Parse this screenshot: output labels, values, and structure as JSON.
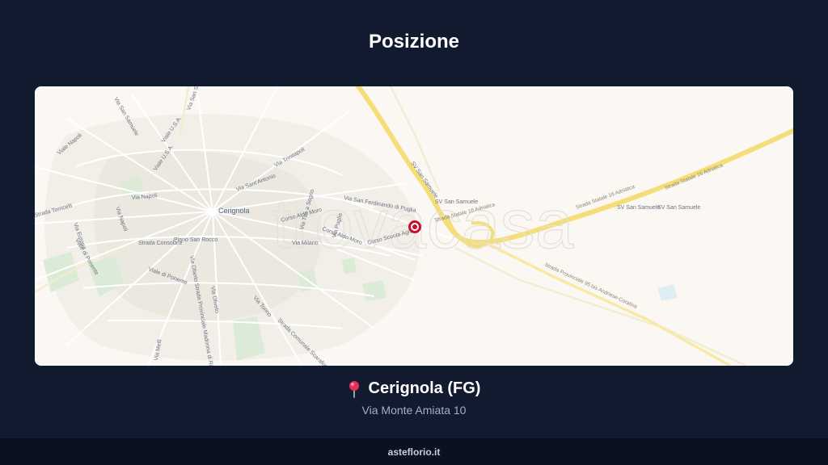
{
  "header": {
    "title": "Posizione"
  },
  "map": {
    "watermark": "trovacasa",
    "city_label": "Cerignola",
    "street_labels": [
      "Viale U.S.A.",
      "Viale U.S.A.",
      "Viale Napoli",
      "Via Napoli",
      "Via Napoli",
      "Viale di Ponente",
      "Viale di Ponente",
      "Strada Consolare",
      "Piano San Rocco",
      "Via Sant'Antonio",
      "Via Tiro a Segno",
      "Via Trinitapoli",
      "Corso Aldo Moro",
      "Corso Aldo Moro",
      "Via Milano",
      "Via Puglia",
      "Corso Scuola Agraria",
      "Via San Ferdinando di Puglia",
      "SV San Samuele",
      "SV San Samuele",
      "SV San Samuele",
      "SV San Samuele",
      "Strada Statale 16 Adriatica",
      "Strada Statale 16 Adriatica",
      "Strada Statale 16 Adriatica",
      "Strada Provinciale 95 bis Andriese-Coratina",
      "Strada Comunale Scarafone",
      "Via Torino",
      "Via Melfi",
      "Via Oliveto",
      "Via Ofanto Strada Provinciale Madonna di Ripalta",
      "Via Europa",
      "Strada Torricelli",
      "Via San Samuele",
      "Via San Severo"
    ],
    "marker": {
      "color": "#c8102e"
    }
  },
  "location": {
    "pin_icon": "round-pushpin-icon",
    "city": "Cerignola (FG)",
    "address": "Via Monte Amiata 10"
  },
  "footer": {
    "brand": "asteflorio.it"
  },
  "colors": {
    "background": "#111a2e",
    "footer_bg": "#0a1120",
    "map_bg": "#fbf8f4",
    "highway": "#f5de7a",
    "marker": "#c8102e"
  }
}
